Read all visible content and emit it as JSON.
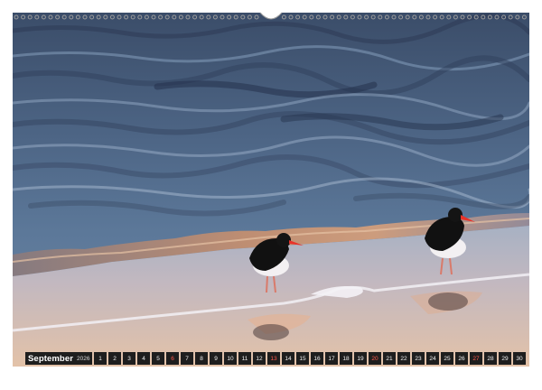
{
  "calendar": {
    "month": "September",
    "year": "2026",
    "days": [
      "1",
      "2",
      "3",
      "4",
      "5",
      "6",
      "7",
      "8",
      "9",
      "10",
      "11",
      "12",
      "13",
      "14",
      "15",
      "16",
      "17",
      "18",
      "19",
      "20",
      "21",
      "22",
      "23",
      "24",
      "25",
      "26",
      "27",
      "28",
      "29",
      "30"
    ],
    "weekend_days": [
      "6",
      "13",
      "20",
      "27"
    ]
  },
  "colors": {
    "weekend_accent": "#ff5a4d",
    "strip_background": "#1e1e1e"
  }
}
